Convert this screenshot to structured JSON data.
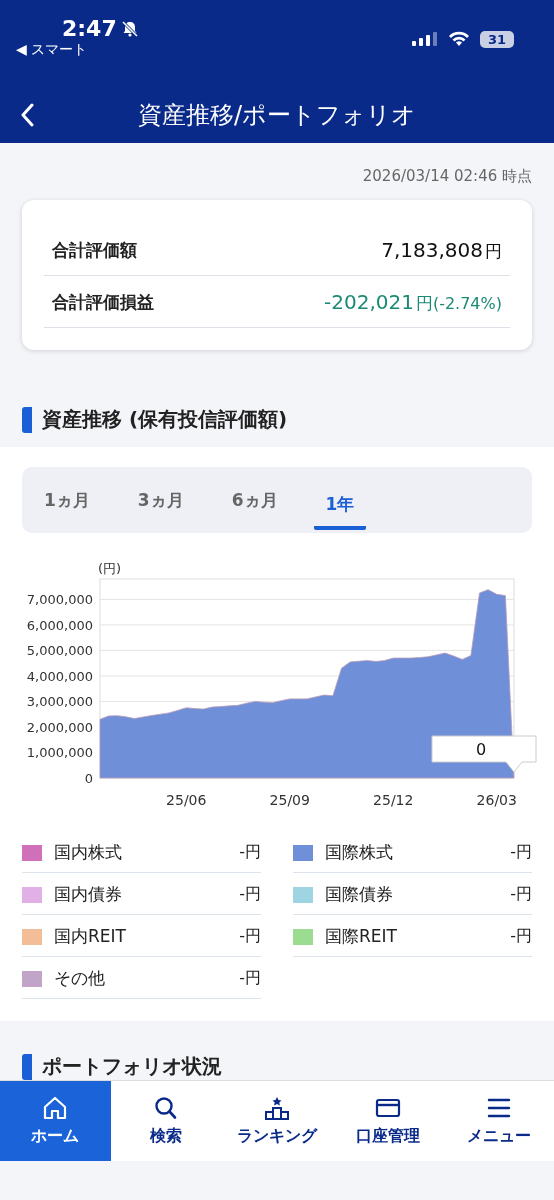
{
  "status_bar": {
    "time": "2:47",
    "back_app": "◀ スマート",
    "battery": "31"
  },
  "header": {
    "title": "資産推移/ポートフォリオ"
  },
  "timestamp": "2026/03/14 02:46 時点",
  "summary": [
    {
      "label": "合計評価額",
      "kind": "plain",
      "value": "7,183,808",
      "unit": "円"
    },
    {
      "label": "合計評価損益",
      "kind": "change",
      "value": "-202,021",
      "unit": "円",
      "percent": "(-2.74%)"
    }
  ],
  "asset_section": {
    "heading": "資産推移 (保有投信評価額)",
    "tabs": [
      {
        "label": "1ヵ月",
        "selected": false
      },
      {
        "label": "3ヵ月",
        "selected": false
      },
      {
        "label": "6ヵ月",
        "selected": false
      },
      {
        "label": "1年",
        "selected": true
      }
    ],
    "chart_data": {
      "type": "area",
      "ylabel": "(円)",
      "ylim": [
        0,
        7800000
      ],
      "categories": [
        null,
        null,
        null,
        null,
        null,
        null,
        null,
        null,
        null,
        null,
        "25/06",
        null,
        null,
        null,
        null,
        null,
        null,
        null,
        null,
        null,
        null,
        null,
        "25/09",
        null,
        null,
        null,
        null,
        null,
        null,
        null,
        null,
        null,
        null,
        null,
        "25/12",
        null,
        null,
        null,
        null,
        null,
        null,
        null,
        null,
        null,
        null,
        null,
        "26/03",
        null,
        null
      ],
      "yticks": [
        {
          "value": 0,
          "label": "0"
        },
        {
          "value": 1000000,
          "label": "1,000,000"
        },
        {
          "value": 2000000,
          "label": "2,000,000"
        },
        {
          "value": 3000000,
          "label": "3,000,000"
        },
        {
          "value": 4000000,
          "label": "4,000,000"
        },
        {
          "value": 5000000,
          "label": "5,000,000"
        },
        {
          "value": 6000000,
          "label": "6,000,000"
        },
        {
          "value": 7000000,
          "label": "7,000,000"
        }
      ],
      "series": [
        {
          "color": "#6f8fd8",
          "values": [
            2300000,
            2430000,
            2440000,
            2400000,
            2330000,
            2390000,
            2450000,
            2500000,
            2550000,
            2650000,
            2750000,
            2720000,
            2700000,
            2780000,
            2800000,
            2830000,
            2850000,
            2930000,
            3000000,
            2970000,
            2950000,
            3030000,
            3100000,
            3100000,
            3100000,
            3180000,
            3250000,
            3220000,
            4300000,
            4550000,
            4580000,
            4600000,
            4570000,
            4600000,
            4700000,
            4700000,
            4700000,
            4720000,
            4750000,
            4820000,
            4900000,
            4780000,
            4650000,
            4800000,
            7250000,
            7380000,
            7200000,
            7150000,
            0
          ]
        }
      ],
      "grid": true,
      "annotations": [
        {
          "y": 0,
          "text": "0"
        }
      ]
    },
    "legend": [
      {
        "label": "国内株式",
        "value": "-円",
        "color": "#d070b8"
      },
      {
        "label": "国際株式",
        "value": "-円",
        "color": "#6f8fd8"
      },
      {
        "label": "国内債券",
        "value": "-円",
        "color": "#e0b0e6"
      },
      {
        "label": "国際債券",
        "value": "-円",
        "color": "#9fd4e2"
      },
      {
        "label": "国内REIT",
        "value": "-円",
        "color": "#f3bd98"
      },
      {
        "label": "国際REIT",
        "value": "-円",
        "color": "#9cdc90"
      },
      {
        "label": "その他",
        "value": "-円",
        "color": "#c0a5c8"
      }
    ]
  },
  "portfolio_section": {
    "heading": "ポートフォリオ状況"
  },
  "bottom_nav": [
    {
      "label": "ホーム",
      "selected": true
    },
    {
      "label": "検索",
      "selected": false
    },
    {
      "label": "ランキング",
      "selected": false
    },
    {
      "label": "口座管理",
      "selected": false
    },
    {
      "label": "メニュー",
      "selected": false
    }
  ]
}
